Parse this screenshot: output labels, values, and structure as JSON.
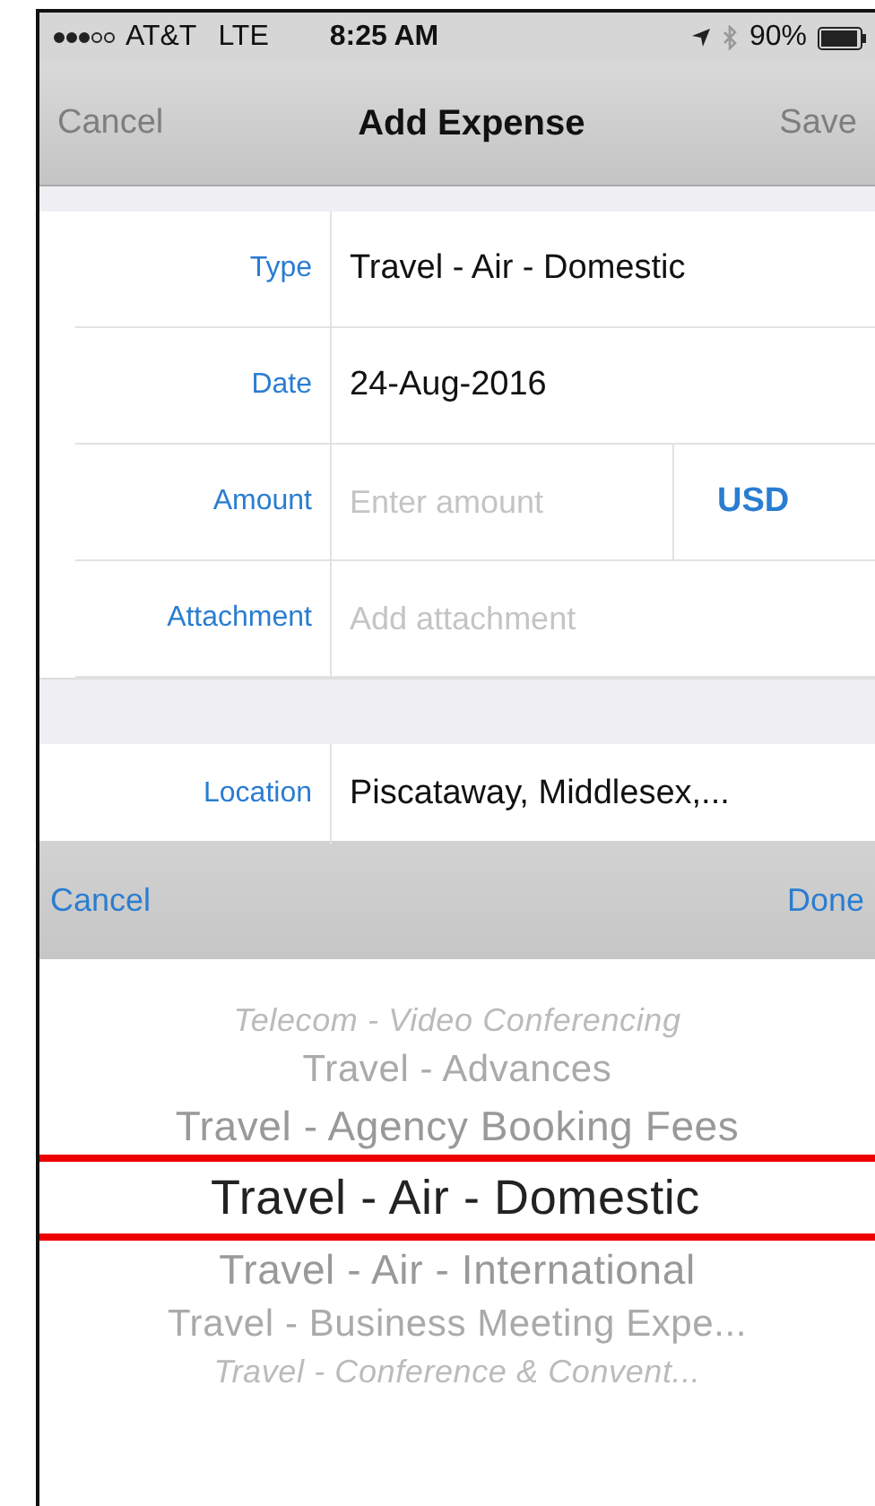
{
  "status_bar": {
    "carrier": "AT&T",
    "network": "LTE",
    "time": "8:25 AM",
    "battery": "90%"
  },
  "nav_bar": {
    "left": "Cancel",
    "title": "Add Expense",
    "right": "Save"
  },
  "form": [
    {
      "label": "Type",
      "value": "Travel - Air - Domestic"
    },
    {
      "label": "Date",
      "value": "24-Aug-2016"
    },
    {
      "label": "Amount",
      "placeholder": "Enter amount",
      "currency": "USD"
    },
    {
      "label": "Attachment",
      "placeholder": "Add attachment"
    }
  ],
  "location": {
    "label": "Location",
    "value": "Piscataway, Middlesex,..."
  },
  "picker_toolbar": {
    "left": "Cancel",
    "right": "Done"
  },
  "picker": [
    {
      "label": "Telecom - Video Conferencing",
      "selected": false
    },
    {
      "label": "Travel - Advances",
      "selected": false
    },
    {
      "label": "Travel - Agency Booking Fees",
      "selected": false
    },
    {
      "label": "Travel - Air - Domestic",
      "selected": true
    },
    {
      "label": "Travel - Air - International",
      "selected": false
    },
    {
      "label": "Travel - Business Meeting Expe...",
      "selected": false
    },
    {
      "label": "Travel - Conference  & Convent...",
      "selected": false
    }
  ]
}
